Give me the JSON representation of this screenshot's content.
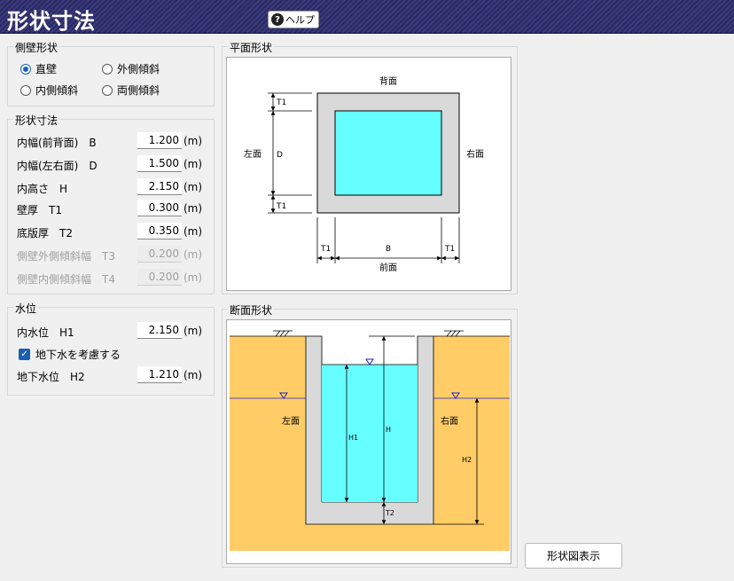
{
  "header": {
    "title": "形状寸法",
    "help_label": "ヘルプ"
  },
  "wall_shape": {
    "legend": "側壁形状",
    "options": [
      {
        "label": "直壁",
        "selected": true
      },
      {
        "label": "外側傾斜",
        "selected": false
      },
      {
        "label": "内側傾斜",
        "selected": false
      },
      {
        "label": "両側傾斜",
        "selected": false
      }
    ]
  },
  "dimensions": {
    "legend": "形状寸法",
    "rows": [
      {
        "label": "内幅(前背面)　B",
        "value": "1.200",
        "unit": "(m)",
        "enabled": true
      },
      {
        "label": "内幅(左右面)　D",
        "value": "1.500",
        "unit": "(m)",
        "enabled": true
      },
      {
        "label": "内高さ　H",
        "value": "2.150",
        "unit": "(m)",
        "enabled": true
      },
      {
        "label": "壁厚　T1",
        "value": "0.300",
        "unit": "(m)",
        "enabled": true
      },
      {
        "label": "底版厚　T2",
        "value": "0.350",
        "unit": "(m)",
        "enabled": true
      },
      {
        "label": "側壁外側傾斜幅　T3",
        "value": "0.200",
        "unit": "(m)",
        "enabled": false
      },
      {
        "label": "側壁内側傾斜幅　T4",
        "value": "0.200",
        "unit": "(m)",
        "enabled": false
      }
    ]
  },
  "water": {
    "legend": "水位",
    "inner_label": "内水位　H1",
    "inner_value": "2.150",
    "inner_unit": "(m)",
    "groundwater_check_label": "地下水を考慮する",
    "groundwater_checked": true,
    "ground_label": "地下水位　H2",
    "ground_value": "1.210",
    "ground_unit": "(m)"
  },
  "plan_view": {
    "legend": "平面形状",
    "back": "背面",
    "front": "前面",
    "left": "左面",
    "right": "右面",
    "t1": "T1",
    "d": "D",
    "b": "B"
  },
  "section_view": {
    "legend": "断面形状",
    "left": "左面",
    "right": "右面",
    "h1": "H1",
    "h": "H",
    "h2": "H2",
    "t2": "T2"
  },
  "show_button_label": "形状図表示",
  "colors": {
    "water": "#66ffff",
    "soil": "#ffcc66",
    "concrete": "#d9d9d9",
    "accent": "#1a5fb4",
    "title_bg": "#2f2f6e"
  }
}
